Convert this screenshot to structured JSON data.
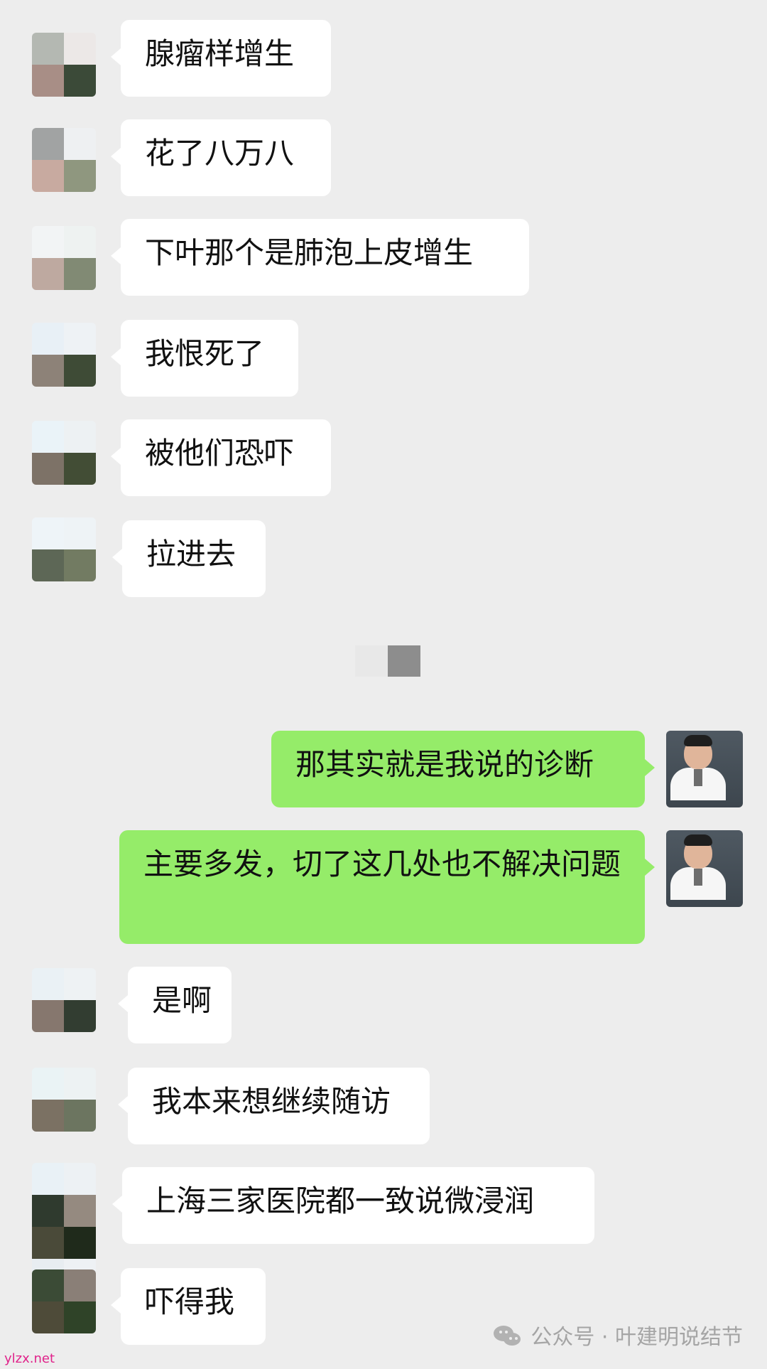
{
  "conversation": {
    "messages": [
      {
        "text": "腺瘤样增生",
        "direction": "incoming"
      },
      {
        "text": "花了八万八",
        "direction": "incoming"
      },
      {
        "text": "下叶那个是肺泡上皮增生",
        "direction": "incoming"
      },
      {
        "text": "我恨死了",
        "direction": "incoming"
      },
      {
        "text": "被他们恐吓",
        "direction": "incoming"
      },
      {
        "text": "拉进去",
        "direction": "incoming"
      },
      {
        "text": "那其实就是我说的诊断",
        "direction": "outgoing"
      },
      {
        "text": "主要多发，切了这几处也不解决问题",
        "direction": "outgoing"
      },
      {
        "text": "是啊",
        "direction": "incoming"
      },
      {
        "text": "我本来想继续随访",
        "direction": "incoming"
      },
      {
        "text": "上海三家医院都一致说微浸润",
        "direction": "incoming"
      },
      {
        "text": "吓得我",
        "direction": "incoming"
      }
    ]
  },
  "watermark": {
    "text": "公众号 · 叶建明说结节",
    "icon": "wechat-icon"
  },
  "site_tag": "ylzx.net",
  "colors": {
    "background": "#ededed",
    "incoming_bubble": "#ffffff",
    "outgoing_bubble": "#95ec69",
    "watermark": "#a5a5a5",
    "site_tag": "#e0228a"
  }
}
